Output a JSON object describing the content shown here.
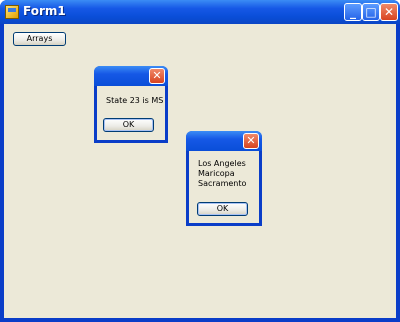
{
  "window": {
    "title": "Form1"
  },
  "titlebar_buttons": {
    "minimize_icon": "minimize-icon",
    "maximize_icon": "maximize-icon",
    "close_icon": "close-icon"
  },
  "form": {
    "arrays_button_label": "Arrays"
  },
  "dialog1": {
    "message": "State 23 is MS",
    "ok_label": "OK"
  },
  "dialog2": {
    "lines": [
      "Los Angeles",
      "Maricopa",
      "Sacramento"
    ],
    "ok_label": "OK"
  }
}
